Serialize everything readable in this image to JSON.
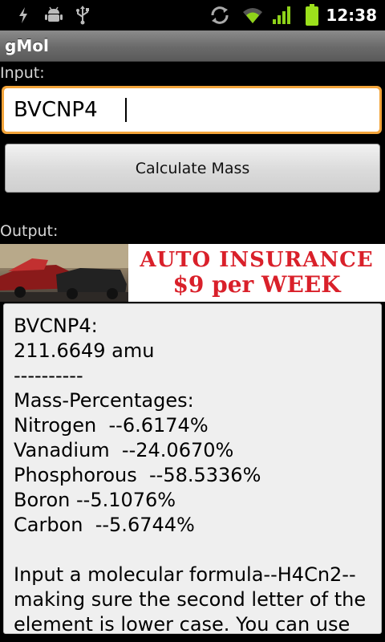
{
  "status_bar": {
    "time": "12:38",
    "icons": [
      "flash-icon",
      "android-debug-icon",
      "usb-icon",
      "sync-icon",
      "wifi-icon",
      "signal-icon",
      "battery-icon"
    ]
  },
  "app": {
    "title": "gMol"
  },
  "input": {
    "label": "Input:",
    "value": "BVCNP4"
  },
  "calculate_button": {
    "label": "Calculate Mass"
  },
  "output": {
    "label": "Output:",
    "lines": [
      "BVCNP4:",
      "211.6649 amu",
      "----------",
      "Mass-Percentages:",
      "Nitrogen  --6.6174%",
      "Vanadium  --24.0670%",
      "Phosphorous  --58.5336%",
      "Boron --5.1076%",
      "Carbon  --5.6744%"
    ],
    "help_text": "Input a molecular formula--H4Cn2--making sure the second letter of the element is lower case.  You can use"
  },
  "ad": {
    "line1": "AUTO INSURANCE",
    "line2": "$9 per WEEK"
  },
  "colors": {
    "focus_border": "#f3a43a",
    "ad_text": "#d9202a",
    "battery": "#9ce01c"
  }
}
